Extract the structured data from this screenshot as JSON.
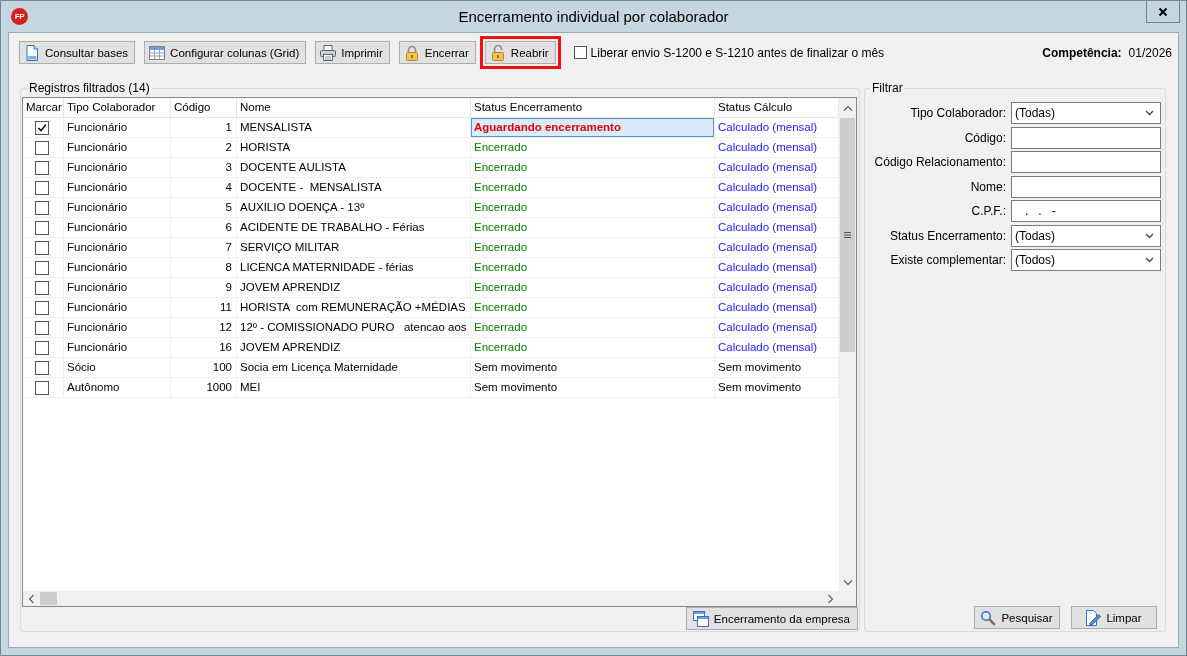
{
  "window": {
    "logo": "FP",
    "title": "Encerramento individual por colaborador"
  },
  "toolbar": {
    "buttons": [
      {
        "label": "Consultar bases",
        "kind": "bases",
        "highlighted": false
      },
      {
        "label": "Configurar colunas (Grid)",
        "kind": "columns",
        "highlighted": false
      },
      {
        "label": "Imprimir",
        "kind": "print",
        "highlighted": false
      },
      {
        "label": "Encerrar",
        "kind": "lock",
        "highlighted": false
      },
      {
        "label": "Reabrir",
        "kind": "unlock",
        "highlighted": true
      }
    ],
    "option": {
      "label": "Liberar envio S-1200 e S-1210 antes de finalizar o mês",
      "checked": false
    },
    "period": {
      "label": "Competência:",
      "value": "01/2026"
    }
  },
  "records": {
    "title": "Registros filtrados (14)",
    "columns": [
      "Marcar",
      "Tipo Colaborador",
      "Código",
      "Nome",
      "Status Encerramento",
      "Status Cálculo"
    ],
    "rows": [
      {
        "checked": true,
        "type": "Funcionário",
        "code": "1",
        "name": "MENSALISTA",
        "closing": {
          "text": "Aguardando encerramento",
          "kind": "pending",
          "focused": true
        },
        "calc": {
          "text": "Calculado (mensal)",
          "kind": "calculated"
        }
      },
      {
        "checked": false,
        "type": "Funcionário",
        "code": "2",
        "name": "HORISTA",
        "closing": {
          "text": "Encerrado",
          "kind": "closed",
          "focused": false
        },
        "calc": {
          "text": "Calculado (mensal)",
          "kind": "calculated"
        }
      },
      {
        "checked": false,
        "type": "Funcionário",
        "code": "3",
        "name": "DOCENTE AULISTA",
        "closing": {
          "text": "Encerrado",
          "kind": "closed",
          "focused": false
        },
        "calc": {
          "text": "Calculado (mensal)",
          "kind": "calculated"
        }
      },
      {
        "checked": false,
        "type": "Funcionário",
        "code": "4",
        "name": "DOCENTE -  MENSALISTA",
        "closing": {
          "text": "Encerrado",
          "kind": "closed",
          "focused": false
        },
        "calc": {
          "text": "Calculado (mensal)",
          "kind": "calculated"
        }
      },
      {
        "checked": false,
        "type": "Funcionário",
        "code": "5",
        "name": "AUXILIO DOENÇA - 13º",
        "closing": {
          "text": "Encerrado",
          "kind": "closed",
          "focused": false
        },
        "calc": {
          "text": "Calculado (mensal)",
          "kind": "calculated"
        }
      },
      {
        "checked": false,
        "type": "Funcionário",
        "code": "6",
        "name": "ACIDENTE DE TRABALHO - Férias",
        "closing": {
          "text": "Encerrado",
          "kind": "closed",
          "focused": false
        },
        "calc": {
          "text": "Calculado (mensal)",
          "kind": "calculated"
        }
      },
      {
        "checked": false,
        "type": "Funcionário",
        "code": "7",
        "name": "SERVIÇO MILITAR",
        "closing": {
          "text": "Encerrado",
          "kind": "closed",
          "focused": false
        },
        "calc": {
          "text": "Calculado (mensal)",
          "kind": "calculated"
        }
      },
      {
        "checked": false,
        "type": "Funcionário",
        "code": "8",
        "name": "LICENCA MATERNIDADE - férias",
        "closing": {
          "text": "Encerrado",
          "kind": "closed",
          "focused": false
        },
        "calc": {
          "text": "Calculado (mensal)",
          "kind": "calculated"
        }
      },
      {
        "checked": false,
        "type": "Funcionário",
        "code": "9",
        "name": "JOVEM APRENDIZ",
        "closing": {
          "text": "Encerrado",
          "kind": "closed",
          "focused": false
        },
        "calc": {
          "text": "Calculado (mensal)",
          "kind": "calculated"
        }
      },
      {
        "checked": false,
        "type": "Funcionário",
        "code": "11",
        "name": "HORISTA  com REMUNERAÇÃO +MÉDIAS",
        "closing": {
          "text": "Encerrado",
          "kind": "closed",
          "focused": false
        },
        "calc": {
          "text": "Calculado (mensal)",
          "kind": "calculated"
        }
      },
      {
        "checked": false,
        "type": "Funcionário",
        "code": "12",
        "name": "12º - COMISSIONADO PURO   atencao aos",
        "closing": {
          "text": "Encerrado",
          "kind": "closed",
          "focused": false
        },
        "calc": {
          "text": "Calculado (mensal)",
          "kind": "calculated"
        }
      },
      {
        "checked": false,
        "type": "Funcionário",
        "code": "16",
        "name": "JOVEM APRENDIZ",
        "closing": {
          "text": "Encerrado",
          "kind": "closed",
          "focused": false
        },
        "calc": {
          "text": "Calculado (mensal)",
          "kind": "calculated"
        }
      },
      {
        "checked": false,
        "type": "Sócio",
        "code": "100",
        "name": "Socia em Licença Maternidade",
        "closing": {
          "text": "Sem movimento",
          "kind": "none",
          "focused": false
        },
        "calc": {
          "text": "Sem movimento",
          "kind": "none"
        }
      },
      {
        "checked": false,
        "type": "Autônomo",
        "code": "1000",
        "name": "MEI",
        "closing": {
          "text": "Sem movimento",
          "kind": "none",
          "focused": false
        },
        "calc": {
          "text": "Sem movimento",
          "kind": "none"
        }
      }
    ],
    "company_button": {
      "label": "Encerramento da empresa",
      "kind": "company"
    }
  },
  "filter": {
    "title": "Filtrar",
    "fields": [
      {
        "label": "Tipo Colaborador:",
        "kind": "select",
        "value": "(Todas)"
      },
      {
        "label": "Código:",
        "kind": "text"
      },
      {
        "label": "Código Relacionamento:",
        "kind": "text"
      },
      {
        "label": "Nome:",
        "kind": "text"
      },
      {
        "label": "C.P.F.:",
        "kind": "text",
        "value": "   .   .   -"
      },
      {
        "label": "Status Encerramento:",
        "kind": "select",
        "value": "(Todas)"
      },
      {
        "label": "Existe complementar:",
        "kind": "select",
        "value": "(Todos)"
      }
    ],
    "buttons": [
      {
        "label": "Pesquisar",
        "kind": "search"
      },
      {
        "label": "Limpar",
        "kind": "clear"
      }
    ]
  }
}
